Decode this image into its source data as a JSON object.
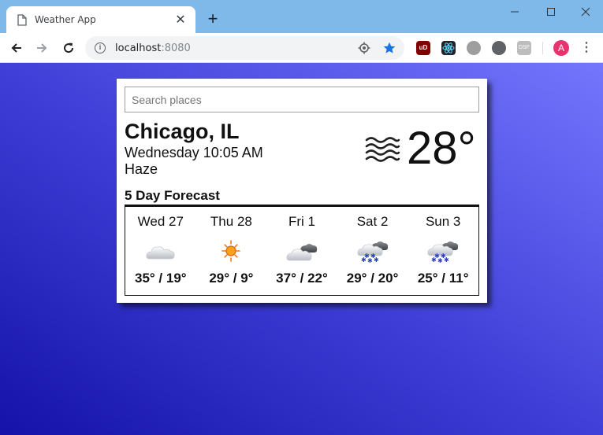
{
  "browser": {
    "tab_title": "Weather App",
    "url_host": "localhost",
    "url_port": ":8080",
    "avatar_letter": "A",
    "ext_ublock_label": "uD",
    "ext_5_label": "DSF"
  },
  "search": {
    "placeholder": "Search places",
    "value": ""
  },
  "current": {
    "city": "Chicago, IL",
    "datetime": "Wednesday 10:05 AM",
    "condition": "Haze",
    "temp": "28°",
    "icon": "haze-icon"
  },
  "forecast": {
    "title": "5 Day Forecast",
    "days": [
      {
        "label": "Wed 27",
        "high": "35°",
        "low": "19°",
        "icon": "cloud-icon"
      },
      {
        "label": "Thu 28",
        "high": "29°",
        "low": "9°",
        "icon": "sun-icon"
      },
      {
        "label": "Fri 1",
        "high": "37°",
        "low": "22°",
        "icon": "clouds-icon"
      },
      {
        "label": "Sat 2",
        "high": "29°",
        "low": "20°",
        "icon": "snow-cloud-icon"
      },
      {
        "label": "Sun 3",
        "high": "25°",
        "low": "11°",
        "icon": "snow-cloud-icon"
      }
    ]
  },
  "colors": {
    "tabbar": "#7eb9ea",
    "gradient_start": "#1412a8",
    "gradient_end": "#7476fd",
    "star": "#1a73e8",
    "avatar": "#e8336f"
  }
}
